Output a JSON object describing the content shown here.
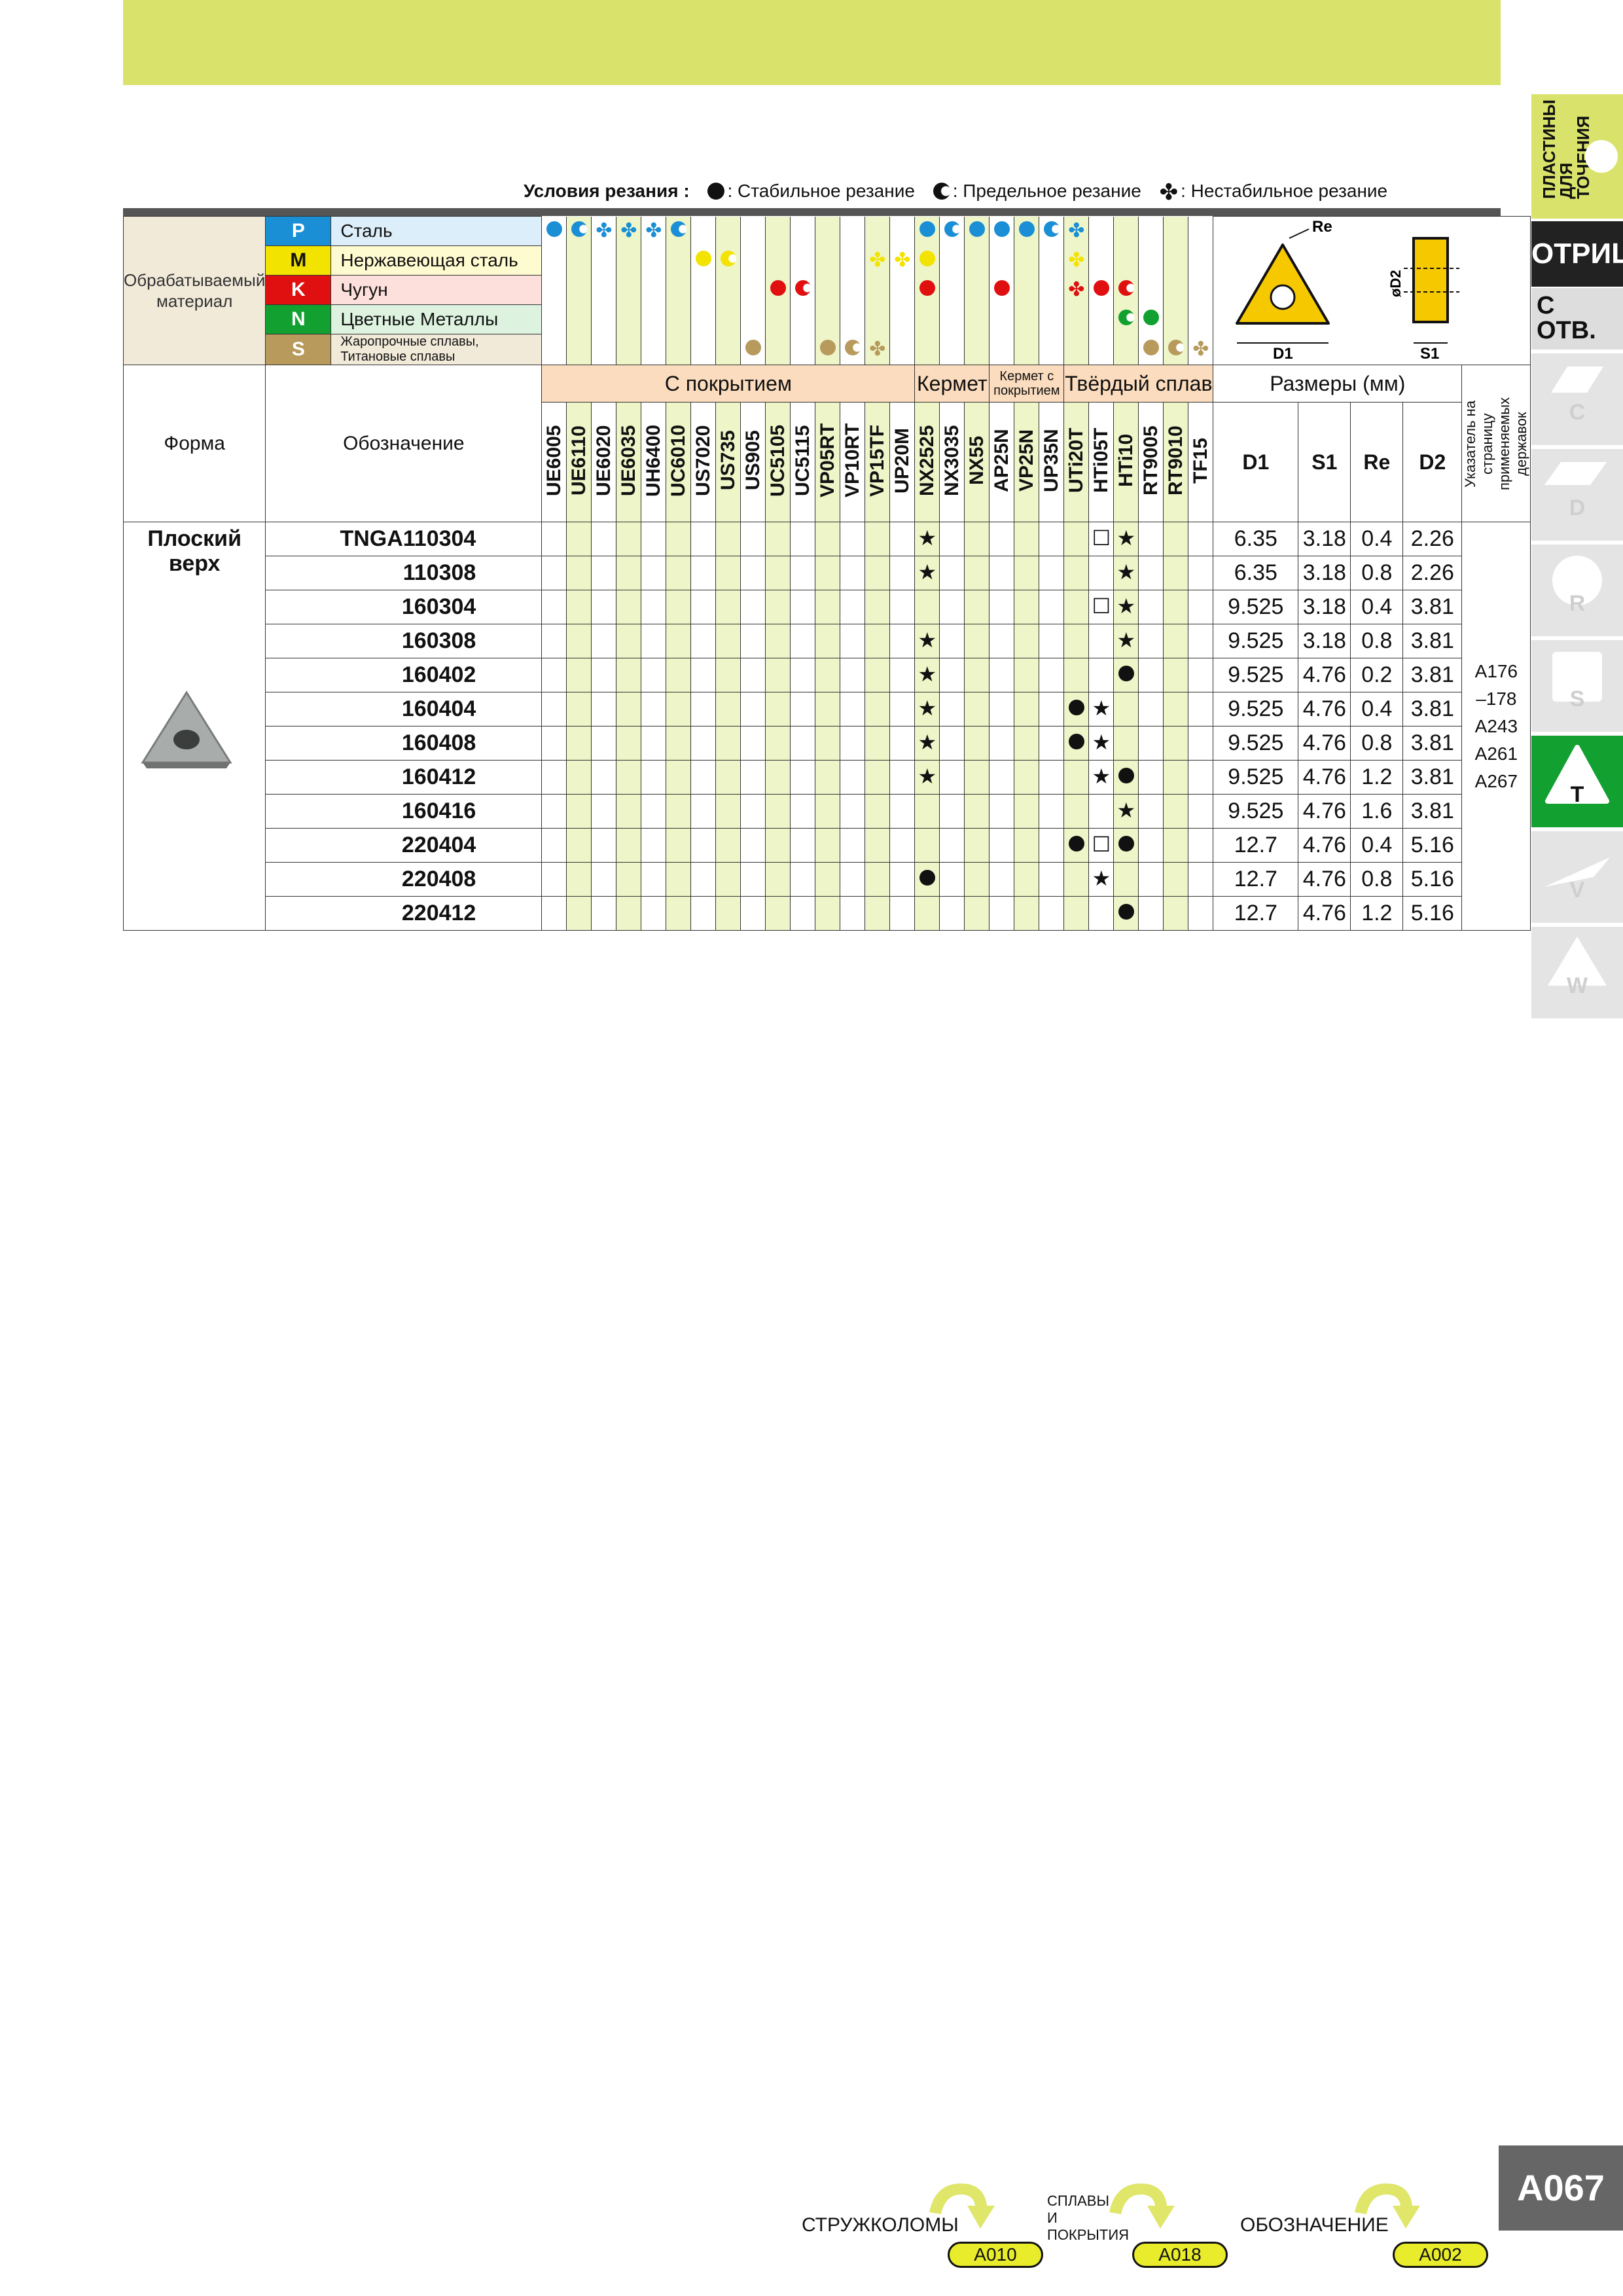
{
  "legend": {
    "title": "Условия резания :",
    "stable": ": Стабильное резание",
    "limit": ": Предельное резание",
    "unstable": ": Нестабильное резание"
  },
  "materials": {
    "group_label": "Обрабатываемый материал",
    "items": [
      {
        "code": "P",
        "name": "Сталь",
        "color": "#1a8fd6"
      },
      {
        "code": "M",
        "name": "Нержавеющая сталь",
        "color": "#f2e300"
      },
      {
        "code": "K",
        "name": "Чугун",
        "color": "#e01010"
      },
      {
        "code": "N",
        "name": "Цветные Металлы",
        "color": "#12a030"
      },
      {
        "code": "S",
        "name": "Жаропрочные сплавы, Титановые сплавы",
        "color": "#b79a5c"
      }
    ]
  },
  "groups": {
    "coated": "С покрытием",
    "cermet": "Кермет",
    "coated_cermet": "Кермет с покрытием",
    "carbide": "Твёрдый сплав",
    "dims": "Размеры (мм)"
  },
  "headers": {
    "shape": "Форма",
    "designation": "Обозначение",
    "d1": "D1",
    "s1": "S1",
    "re": "Re",
    "d2": "D2",
    "holder_ref": "Указатель на страницу применяемых державок"
  },
  "grades": [
    "UE6005",
    "UE6110",
    "UE6020",
    "UE6035",
    "UH6400",
    "UC6010",
    "US7020",
    "US735",
    "US905",
    "UC5105",
    "UC5115",
    "VP05RT",
    "VP10RT",
    "VP15TF",
    "UP20M",
    "NX2525",
    "NX3035",
    "NX55",
    "AP25N",
    "VP25N",
    "UP35N",
    "UTi20T",
    "HTi05T",
    "HTi10",
    "RT9005",
    "RT9010",
    "TF15"
  ],
  "shape_name": "Плоский верх",
  "rows": [
    {
      "code": "TNGA110304",
      "d1": "6.35",
      "s1": "3.18",
      "re": "0.4",
      "d2": "2.26"
    },
    {
      "code": "110308",
      "d1": "6.35",
      "s1": "3.18",
      "re": "0.8",
      "d2": "2.26"
    },
    {
      "code": "160304",
      "d1": "9.525",
      "s1": "3.18",
      "re": "0.4",
      "d2": "3.81"
    },
    {
      "code": "160308",
      "d1": "9.525",
      "s1": "3.18",
      "re": "0.8",
      "d2": "3.81"
    },
    {
      "code": "160402",
      "d1": "9.525",
      "s1": "4.76",
      "re": "0.2",
      "d2": "3.81"
    },
    {
      "code": "160404",
      "d1": "9.525",
      "s1": "4.76",
      "re": "0.4",
      "d2": "3.81"
    },
    {
      "code": "160408",
      "d1": "9.525",
      "s1": "4.76",
      "re": "0.8",
      "d2": "3.81"
    },
    {
      "code": "160412",
      "d1": "9.525",
      "s1": "4.76",
      "re": "1.2",
      "d2": "3.81"
    },
    {
      "code": "160416",
      "d1": "9.525",
      "s1": "4.76",
      "re": "1.6",
      "d2": "3.81"
    },
    {
      "code": "220404",
      "d1": "12.7",
      "s1": "4.76",
      "re": "0.4",
      "d2": "5.16"
    },
    {
      "code": "220408",
      "d1": "12.7",
      "s1": "4.76",
      "re": "0.8",
      "d2": "5.16"
    },
    {
      "code": "220412",
      "d1": "12.7",
      "s1": "4.76",
      "re": "1.2",
      "d2": "5.16"
    }
  ],
  "holder_pages": "A176 –178 A243 A261 A267",
  "diagram": {
    "re": "Re",
    "d1": "D1",
    "d2": "øD2",
    "s1": "S1"
  },
  "sidebar": {
    "top": "ПЛАСТИНЫ ДЛЯ ТОЧЕНИЯ",
    "neg": "ОТРИЦ.",
    "hole": "С ОТВ.",
    "tabs": [
      "C",
      "D",
      "R",
      "S",
      "T",
      "V",
      "W"
    ]
  },
  "page_number": "A067",
  "footer": [
    {
      "label": "СТРУЖКОЛОМЫ",
      "page": "A010"
    },
    {
      "label": "СПЛАВЫ И ПОКРЫТИЯ",
      "page": "A018"
    },
    {
      "label": "ОБОЗНАЧЕНИЕ",
      "page": "A002"
    }
  ]
}
